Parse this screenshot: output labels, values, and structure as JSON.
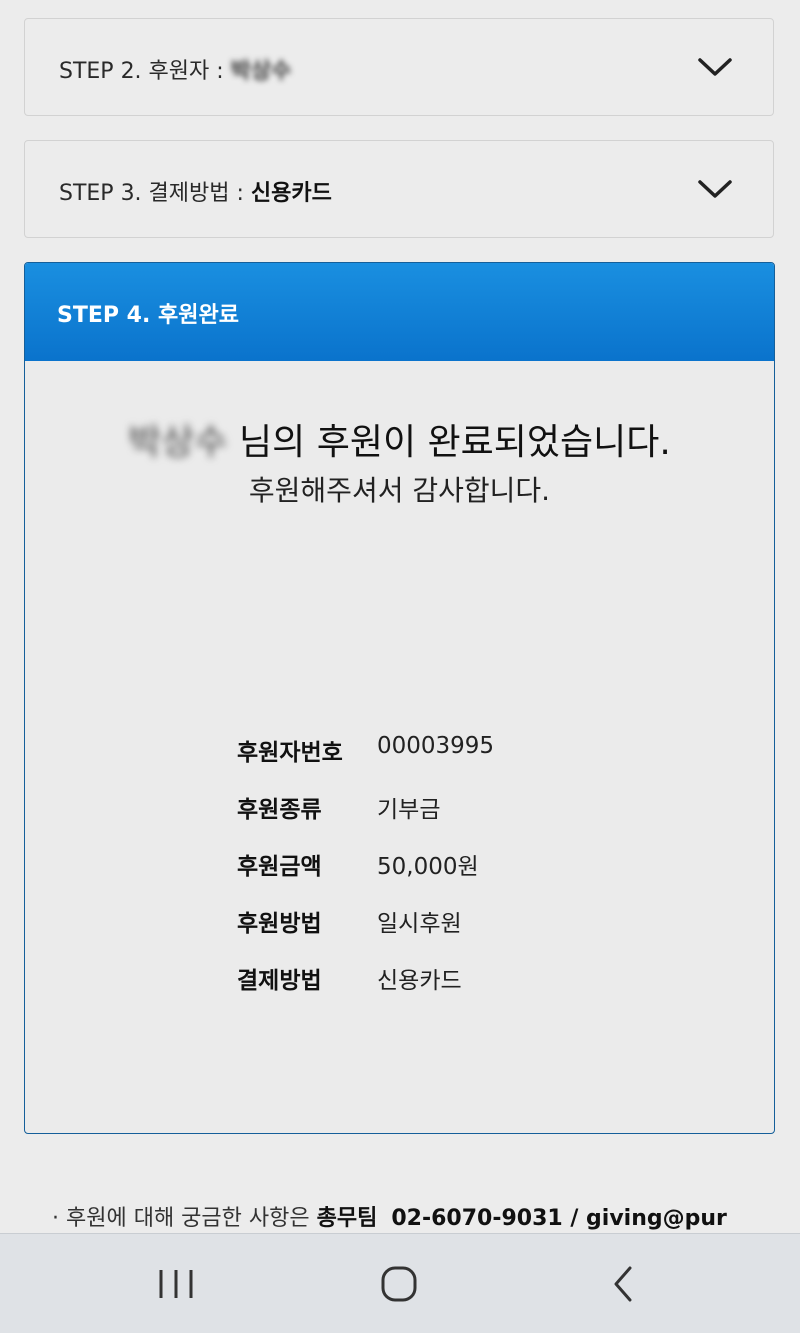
{
  "step2": {
    "label": "STEP 2. 후원자 : ",
    "value": "박상수"
  },
  "step3": {
    "label": "STEP 3. 결제방법 : ",
    "value": "신용카드"
  },
  "step4": {
    "title": "STEP 4. 후원완료",
    "donor_name": "박상수",
    "completion_message": "님의 후원이 완료되었습니다.",
    "thanks_message": "후원해주셔서 감사합니다.",
    "details": [
      {
        "label": "후원자번호",
        "value": "00003995"
      },
      {
        "label": "후원종류",
        "value": "기부금"
      },
      {
        "label": "후원금액",
        "value": "50,000원"
      },
      {
        "label": "후원방법",
        "value": "일시후원"
      },
      {
        "label": "결제방법",
        "value": "신용카드"
      }
    ]
  },
  "footer": {
    "prefix": "· 후원에 대해 궁금한 사항은 ",
    "team": "총무팀",
    "contact": "02-6070-9031 / giving@pur"
  },
  "navbar": {
    "icons": [
      "recent-apps-icon",
      "home-icon",
      "back-icon"
    ]
  },
  "colors": {
    "header_blue": "#0a73cc",
    "panel_border": "#155f9a",
    "background": "#ececec"
  }
}
